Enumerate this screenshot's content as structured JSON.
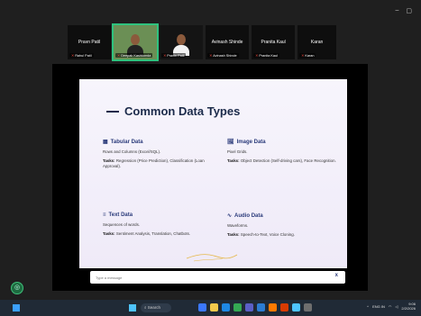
{
  "window": {
    "minimize": "–",
    "maximize": "▢"
  },
  "participants": [
    {
      "name": "Pravn Patil",
      "tag": "Rahul Patil",
      "type": "name"
    },
    {
      "name": "",
      "tag": "Deepak Kashkonda",
      "type": "video-active"
    },
    {
      "name": "",
      "tag": "Pravin Patil",
      "type": "video"
    },
    {
      "name": "Avinash Shinde",
      "tag": "Avinash Shinde",
      "type": "name"
    },
    {
      "name": "Pranita Kaul",
      "tag": "Pranita Kaul",
      "type": "name"
    },
    {
      "name": "Karan",
      "tag": "Karan",
      "type": "name"
    }
  ],
  "slide": {
    "title": "Common Data Types",
    "cards": [
      {
        "icon": "▦",
        "heading": "Tabular Data",
        "desc": "Rows and Columns (Excel/SQL).",
        "tasks_label": "Tasks:",
        "tasks": "Regression (Price Prediction), Classification (Loan Approval)."
      },
      {
        "icon": "🖼",
        "heading": "Image Data",
        "desc": "Pixel Grids.",
        "tasks_label": "Tasks:",
        "tasks": "Object Detection (Self-driving cars), Face Recognition."
      },
      {
        "icon": "≡",
        "heading": "Text Data",
        "desc": "Sequences of words.",
        "tasks_label": "Tasks:",
        "tasks": "Sentiment Analysis, Translation, Chatbots."
      },
      {
        "icon": "∿",
        "heading": "Audio Data",
        "desc": "Waveforms.",
        "tasks_label": "Tasks:",
        "tasks": "Speech-to-Text, Voice Cloning."
      }
    ]
  },
  "chat": {
    "placeholder": "Type a message",
    "close": "x"
  },
  "taskbar": {
    "search": "Search",
    "lang": "ENG IN",
    "time": "9:06",
    "date": "2/2/2026"
  },
  "colors": {
    "accent": "#2ec27e",
    "slide_title": "#1b2a4a",
    "taskbar": "#202a36"
  }
}
